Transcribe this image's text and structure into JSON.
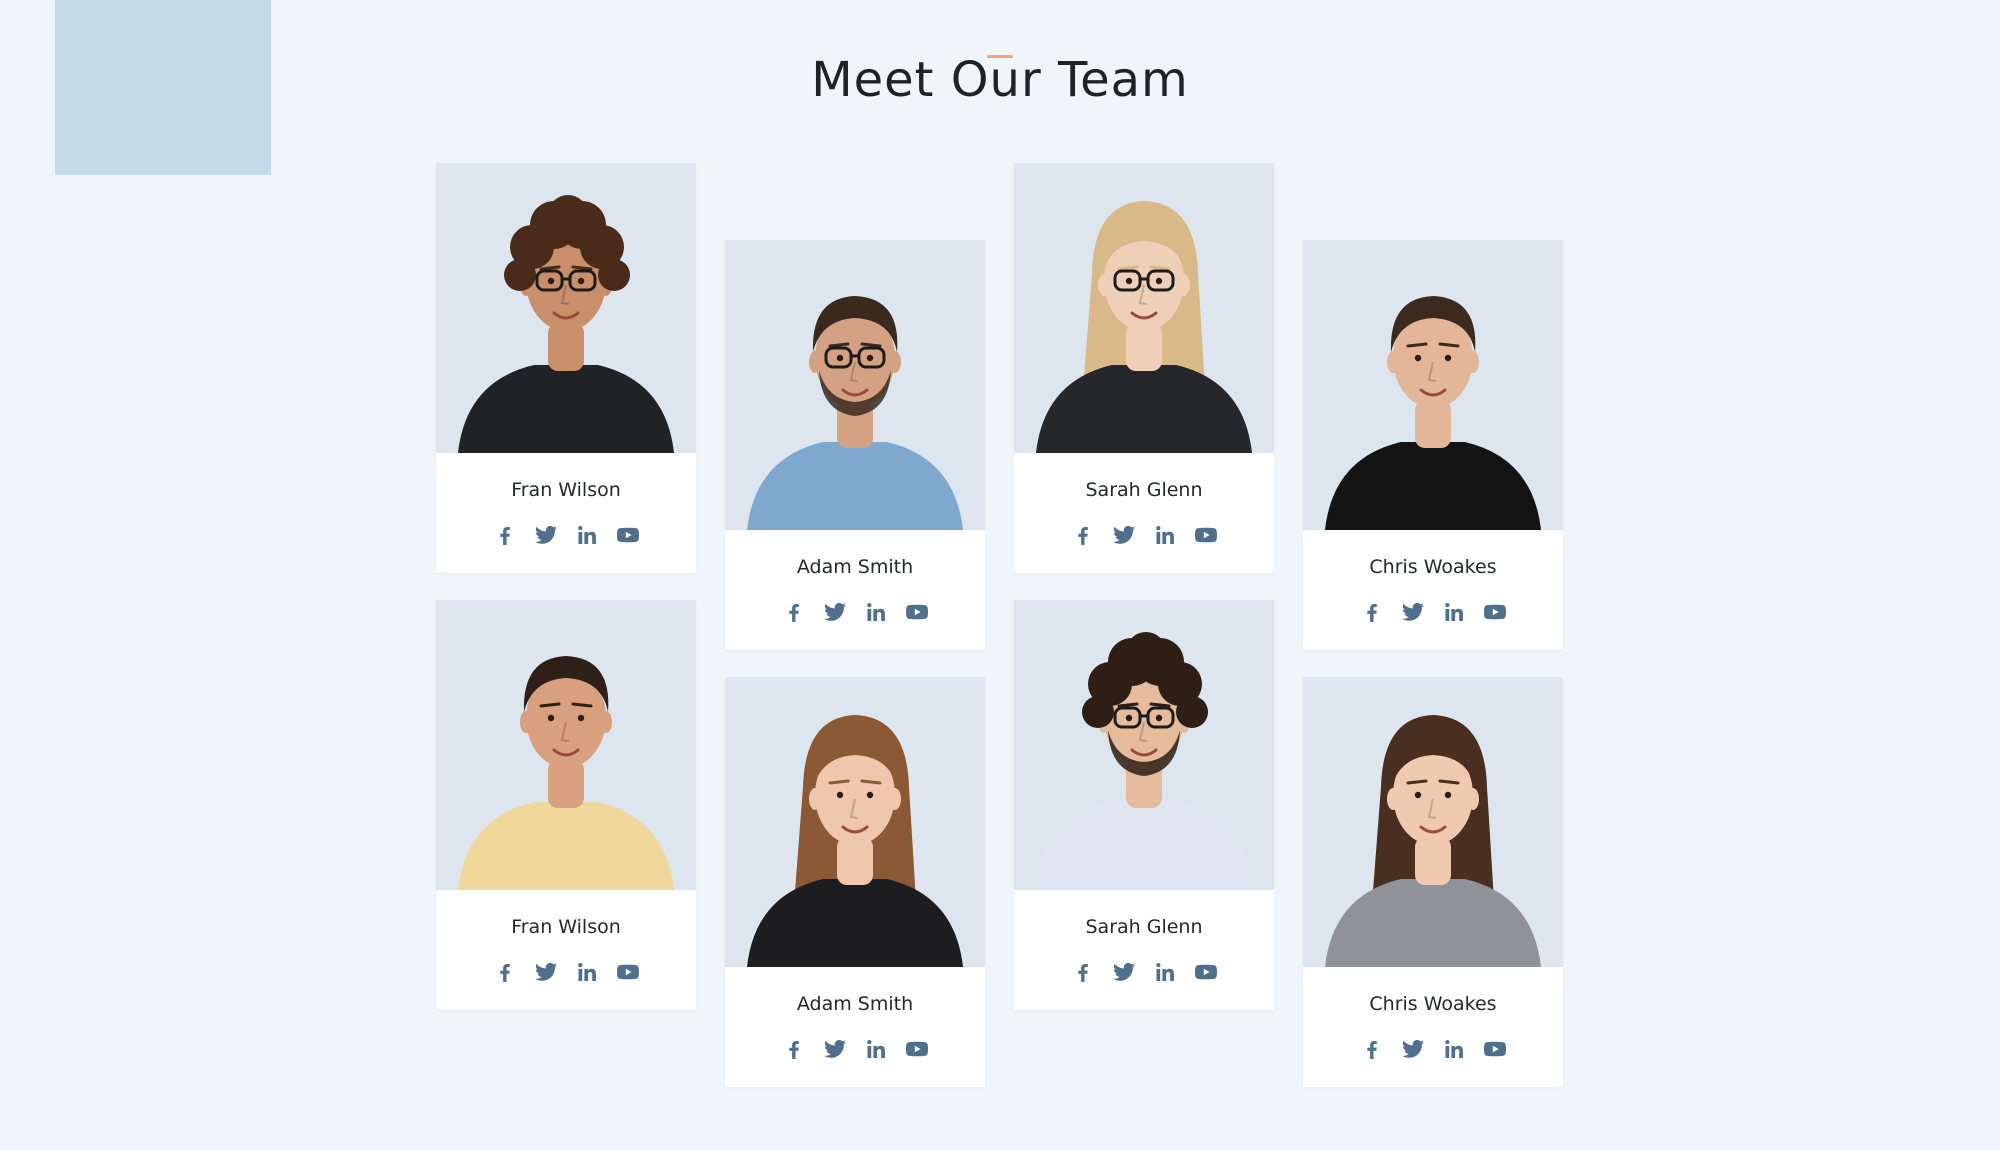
{
  "header": {
    "title": "Meet Our Team"
  },
  "colors": {
    "background": "#f0f5f9",
    "accent_square": "#c6dbe9",
    "accent_line": "#f3a37a",
    "icon": "#4f6f8c",
    "card": "#ffffff",
    "photo_bg": "#dde6ef"
  },
  "team": [
    {
      "name": "Fran Wilson",
      "photo": "woman-curly-hair-glasses"
    },
    {
      "name": "Adam Smith",
      "photo": "man-beard-glasses"
    },
    {
      "name": "Sarah Glenn",
      "photo": "woman-blonde-glasses"
    },
    {
      "name": "Chris Woakes",
      "photo": "man-black-tshirt"
    },
    {
      "name": "Fran Wilson",
      "photo": "man-yellow-tshirt"
    },
    {
      "name": "Adam Smith",
      "photo": "woman-long-hair"
    },
    {
      "name": "Sarah Glenn",
      "photo": "man-curly-hair-glasses"
    },
    {
      "name": "Chris Woakes",
      "photo": "woman-grey-hoodie"
    }
  ],
  "social_icons": [
    "facebook-icon",
    "twitter-icon",
    "linkedin-icon",
    "youtube-icon"
  ]
}
